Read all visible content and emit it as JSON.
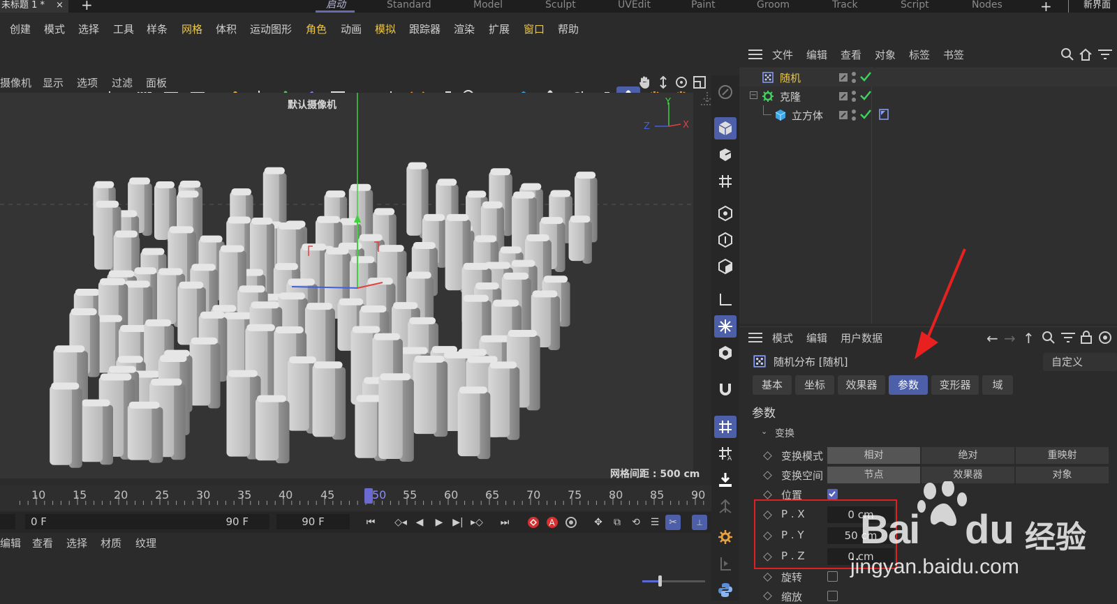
{
  "titlebar": {
    "doc_tab": "未标题 1 *",
    "close": "×",
    "new_tab": "+",
    "layouts": [
      "启动",
      "Standard",
      "Model",
      "Sculpt",
      "UVEdit",
      "Paint",
      "Groom",
      "Track",
      "Script",
      "Nodes"
    ],
    "layout_plus": "+",
    "new_ui": "新界面"
  },
  "menubar": [
    "创建",
    "模式",
    "选择",
    "工具",
    "样条",
    "网格",
    "体积",
    "运动图形",
    "角色",
    "动画",
    "模拟",
    "跟踪器",
    "渲染",
    "扩展",
    "窗口",
    "帮助"
  ],
  "viewport": {
    "menu": [
      "摄像机",
      "显示",
      "选项",
      "过滤",
      "面板"
    ],
    "camera_label": "默认摄像机",
    "grid_label": "网格间距 : 500 cm",
    "axis_labels": {
      "y": "Y",
      "z": "Z",
      "x": "X"
    },
    "colors": {
      "bg": "#343434",
      "x_axis": "#e04040",
      "y_axis": "#40d040",
      "z_axis": "#4060e0"
    }
  },
  "timeline": {
    "ticks": [
      "10",
      "15",
      "20",
      "25",
      "30",
      "35",
      "40",
      "45",
      "50",
      "55",
      "60",
      "65",
      "70",
      "75",
      "80",
      "85",
      "90"
    ],
    "current": "50",
    "start_field": "0 F",
    "end_field": "90 F",
    "end_field2": "90 F"
  },
  "material_menu": [
    "编辑",
    "查看",
    "选择",
    "材质",
    "纹理"
  ],
  "object_manager": {
    "menu": [
      "文件",
      "编辑",
      "查看",
      "对象",
      "标签",
      "书签"
    ],
    "objects": [
      {
        "name": "随机",
        "icon": "random-effector-icon",
        "highlight": true
      },
      {
        "name": "克隆",
        "icon": "cloner-icon",
        "highlight": false
      },
      {
        "name": "立方体",
        "icon": "cube-icon",
        "highlight": false
      }
    ]
  },
  "attributes": {
    "menu": [
      "模式",
      "编辑",
      "用户数据"
    ],
    "title": "随机分布 [随机]",
    "custom_dropdown": "自定义",
    "tabs": [
      "基本",
      "坐标",
      "效果器",
      "参数",
      "变形器",
      "域"
    ],
    "active_tab": "参数",
    "section": "参数",
    "subsection": "变换",
    "transform_mode": {
      "label": "变换模式",
      "options": [
        "相对",
        "绝对",
        "重映射"
      ],
      "selected": "相对"
    },
    "transform_space": {
      "label": "变换空间",
      "options": [
        "节点",
        "效果器",
        "对象"
      ],
      "selected": "节点"
    },
    "position": {
      "label": "位置",
      "checked": true
    },
    "px": {
      "label": "P . X",
      "value": "0 cm"
    },
    "py": {
      "label": "P . Y",
      "value": "50 cm"
    },
    "pz": {
      "label": "P . Z",
      "value": "0 cm"
    },
    "rotation": {
      "label": "旋转",
      "checked": false
    },
    "scale": {
      "label": "缩放",
      "checked": false
    }
  },
  "watermark": {
    "brand": "Bai",
    "brand2": "du",
    "cn": "经验",
    "url": "jingyan.baidu.com"
  },
  "accent": "#4d5fa8"
}
